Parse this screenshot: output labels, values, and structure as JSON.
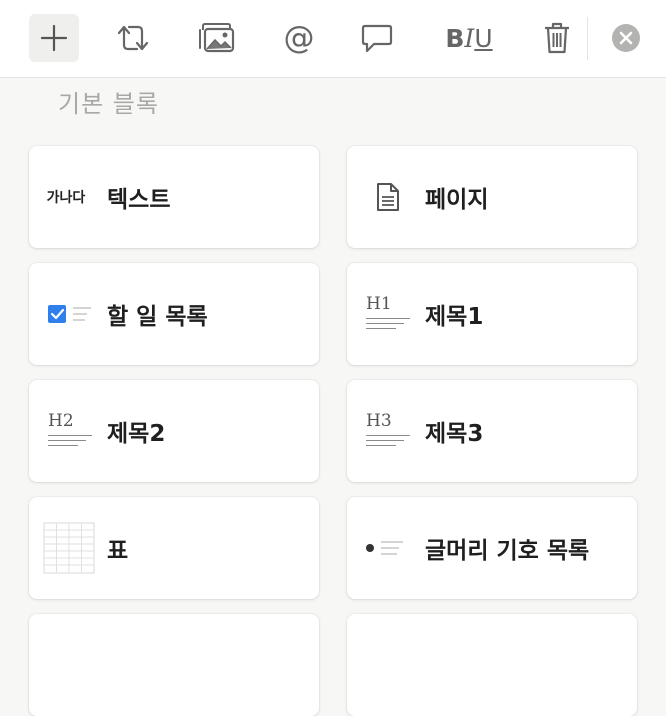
{
  "toolbar": {
    "buttons": [
      {
        "icon": "plus-icon",
        "active": true
      },
      {
        "icon": "turn-into-icon"
      },
      {
        "icon": "image-icon"
      },
      {
        "icon": "mention-icon",
        "glyph": "@"
      },
      {
        "icon": "comment-icon"
      },
      {
        "icon": "text-format-icon",
        "bold": "B",
        "italic": "I",
        "underline": "U"
      },
      {
        "icon": "trash-icon"
      },
      {
        "icon": "close-icon"
      }
    ]
  },
  "section": {
    "label": "기본 블록"
  },
  "blocks": [
    {
      "label": "텍스트",
      "icon": "text-icon",
      "icon_text": "가나다"
    },
    {
      "label": "페이지",
      "icon": "page-icon"
    },
    {
      "label": "할 일 목록",
      "icon": "todo-checkbox-icon"
    },
    {
      "label": "제목1",
      "icon": "heading1-icon",
      "icon_text": "H1"
    },
    {
      "label": "제목2",
      "icon": "heading2-icon",
      "icon_text": "H2"
    },
    {
      "label": "제목3",
      "icon": "heading3-icon",
      "icon_text": "H3"
    },
    {
      "label": "표",
      "icon": "table-icon"
    },
    {
      "label": "글머리 기호 목록",
      "icon": "bulleted-list-icon"
    }
  ],
  "colors": {
    "checkbox": "#2f80ed",
    "icon_gray": "#6b6b6b",
    "close_bg": "#b3b3b1"
  }
}
